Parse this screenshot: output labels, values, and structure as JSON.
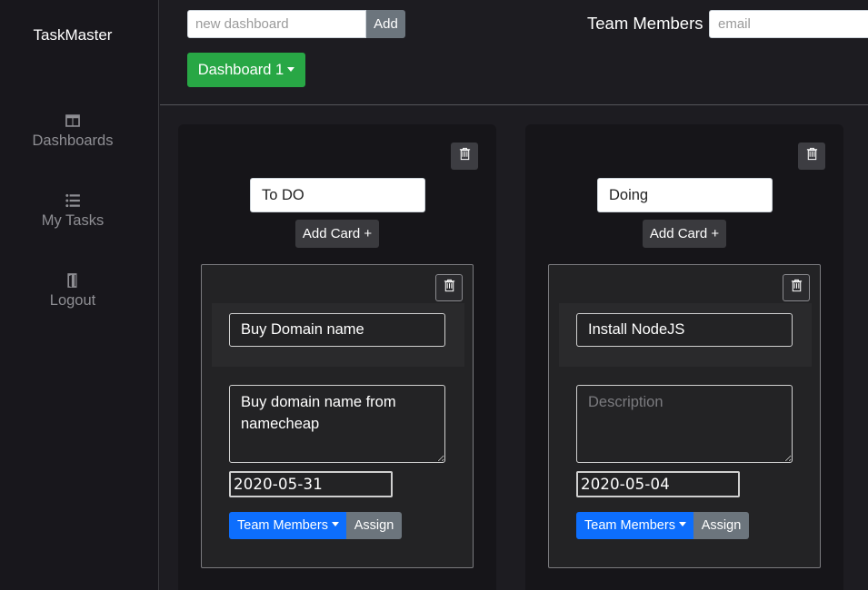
{
  "app": {
    "brand": "TaskMaster"
  },
  "sidebar": {
    "items": [
      {
        "label": "Dashboards",
        "icon": "columns-icon"
      },
      {
        "label": "My Tasks",
        "icon": "list-icon"
      },
      {
        "label": "Logout",
        "icon": "door-exit-icon"
      }
    ]
  },
  "topbar": {
    "new_dashboard_placeholder": "new dashboard",
    "add_label": "Add",
    "team_members_label": "Team Members",
    "email_placeholder": "email",
    "dashboard_selector": "Dashboard 1"
  },
  "columns": [
    {
      "title": "To DO",
      "add_card_label": "Add Card +",
      "cards": [
        {
          "title": "Buy Domain name",
          "description": "Buy domain name from namecheap",
          "description_placeholder": "Description",
          "date": "2020-05-31",
          "team_members_label": "Team Members",
          "assign_label": "Assign"
        }
      ]
    },
    {
      "title": "Doing",
      "add_card_label": "Add Card +",
      "cards": [
        {
          "title": "Install NodeJS",
          "description": "",
          "description_placeholder": "Description",
          "date": "2020-05-04",
          "team_members_label": "Team Members",
          "assign_label": "Assign"
        }
      ]
    }
  ],
  "colors": {
    "background": "#1d1c21",
    "sidebar": "#18171c",
    "success": "#28a745",
    "primary": "#0d6efd",
    "secondary": "#6c757d"
  }
}
